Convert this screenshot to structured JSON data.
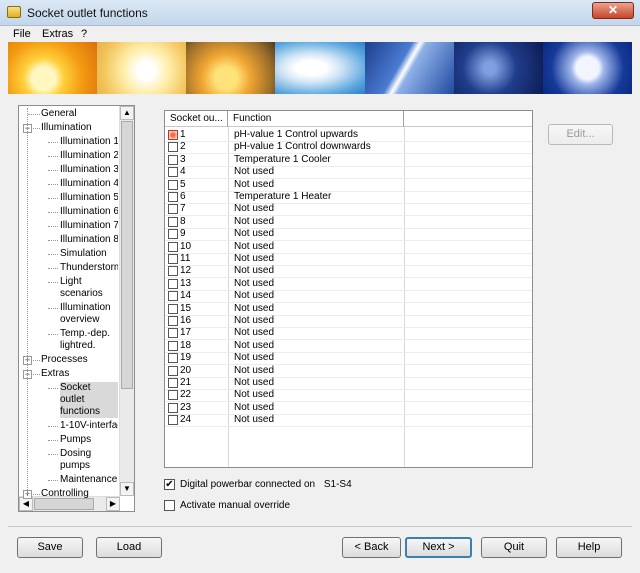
{
  "window": {
    "title": "Socket outlet functions",
    "close_label": "✕"
  },
  "menu": {
    "items": [
      "File",
      "Extras",
      "?"
    ]
  },
  "tree": {
    "items": [
      {
        "label": "General",
        "indent": 0,
        "expander": ""
      },
      {
        "label": "Illumination",
        "indent": 0,
        "expander": "−"
      },
      {
        "label": "Illumination 1",
        "indent": 1,
        "expander": ""
      },
      {
        "label": "Illumination 2",
        "indent": 1,
        "expander": ""
      },
      {
        "label": "Illumination 3",
        "indent": 1,
        "expander": ""
      },
      {
        "label": "Illumination 4",
        "indent": 1,
        "expander": ""
      },
      {
        "label": "Illumination 5",
        "indent": 1,
        "expander": ""
      },
      {
        "label": "Illumination 6",
        "indent": 1,
        "expander": ""
      },
      {
        "label": "Illumination 7",
        "indent": 1,
        "expander": ""
      },
      {
        "label": "Illumination 8",
        "indent": 1,
        "expander": ""
      },
      {
        "label": "Simulation",
        "indent": 1,
        "expander": ""
      },
      {
        "label": "Thunderstorm",
        "indent": 1,
        "expander": ""
      },
      {
        "label": "Light\nscenarios",
        "indent": 1,
        "expander": ""
      },
      {
        "label": "Illumination\noverview",
        "indent": 1,
        "expander": ""
      },
      {
        "label": "Temp.-dep.\nlightred.",
        "indent": 1,
        "expander": ""
      },
      {
        "label": "Processes",
        "indent": 0,
        "expander": "+"
      },
      {
        "label": "Extras",
        "indent": 0,
        "expander": "−"
      },
      {
        "label": "Socket\noutlet\nfunctions",
        "indent": 1,
        "expander": "",
        "selected": true
      },
      {
        "label": "1-10V-interface",
        "indent": 1,
        "expander": ""
      },
      {
        "label": "Pumps",
        "indent": 1,
        "expander": ""
      },
      {
        "label": "Dosing\npumps",
        "indent": 1,
        "expander": ""
      },
      {
        "label": "Maintenance",
        "indent": 1,
        "expander": ""
      },
      {
        "label": "Controlling",
        "indent": 0,
        "expander": "+"
      }
    ]
  },
  "table": {
    "col_socket": "Socket ou...",
    "col_function": "Function",
    "rows": [
      {
        "num": "1",
        "function": "pH-value 1 Control upwards",
        "active": true
      },
      {
        "num": "2",
        "function": "pH-value 1 Control downwards"
      },
      {
        "num": "3",
        "function": "Temperature 1 Cooler"
      },
      {
        "num": "4",
        "function": "Not used"
      },
      {
        "num": "5",
        "function": "Not used"
      },
      {
        "num": "6",
        "function": "Temperature 1 Heater"
      },
      {
        "num": "7",
        "function": "Not used"
      },
      {
        "num": "8",
        "function": "Not used"
      },
      {
        "num": "9",
        "function": "Not used"
      },
      {
        "num": "10",
        "function": "Not used"
      },
      {
        "num": "11",
        "function": "Not used"
      },
      {
        "num": "12",
        "function": "Not used"
      },
      {
        "num": "13",
        "function": "Not used"
      },
      {
        "num": "14",
        "function": "Not used"
      },
      {
        "num": "15",
        "function": "Not used"
      },
      {
        "num": "16",
        "function": "Not used"
      },
      {
        "num": "17",
        "function": "Not used"
      },
      {
        "num": "18",
        "function": "Not used"
      },
      {
        "num": "19",
        "function": "Not used"
      },
      {
        "num": "20",
        "function": "Not used"
      },
      {
        "num": "21",
        "function": "Not used"
      },
      {
        "num": "22",
        "function": "Not used"
      },
      {
        "num": "23",
        "function": "Not used"
      },
      {
        "num": "24",
        "function": "Not used"
      }
    ]
  },
  "edit_button": "Edit...",
  "options": {
    "digital_powerbar_label": "Digital powerbar connected on",
    "digital_powerbar_value": "S1-S4",
    "digital_powerbar_checked": true,
    "manual_override_label": "Activate manual override",
    "manual_override_checked": false
  },
  "footer": {
    "save": "Save",
    "load": "Load",
    "back": "< Back",
    "next": "Next >",
    "quit": "Quit",
    "help": "Help"
  }
}
